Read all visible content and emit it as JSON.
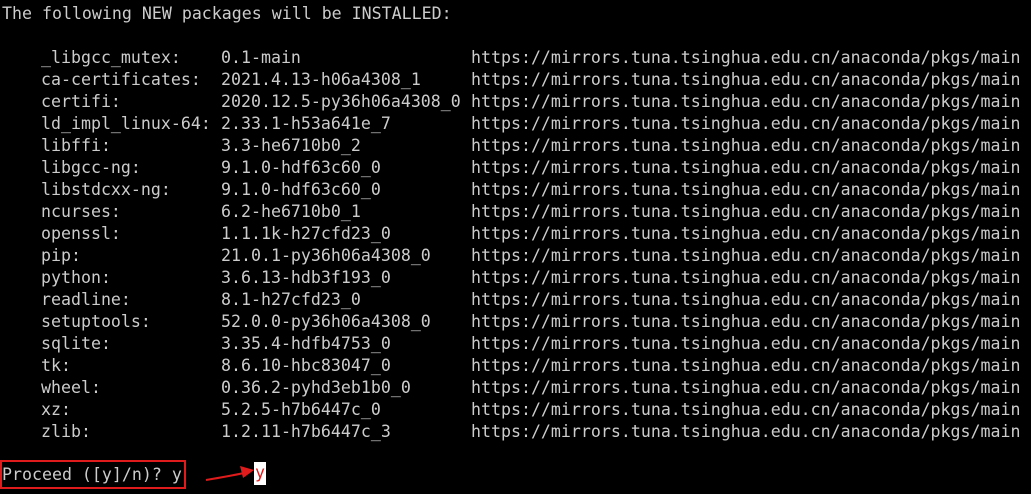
{
  "header": "The following NEW packages will be INSTALLED:",
  "packages": [
    {
      "name": "_libgcc_mutex:",
      "version": "0.1-main",
      "channel": "https://mirrors.tuna.tsinghua.edu.cn/anaconda/pkgs/main"
    },
    {
      "name": "ca-certificates:",
      "version": "2021.4.13-h06a4308_1",
      "channel": "https://mirrors.tuna.tsinghua.edu.cn/anaconda/pkgs/main"
    },
    {
      "name": "certifi:",
      "version": "2020.12.5-py36h06a4308_0",
      "channel": "https://mirrors.tuna.tsinghua.edu.cn/anaconda/pkgs/main"
    },
    {
      "name": "ld_impl_linux-64:",
      "version": "2.33.1-h53a641e_7",
      "channel": "https://mirrors.tuna.tsinghua.edu.cn/anaconda/pkgs/main"
    },
    {
      "name": "libffi:",
      "version": "3.3-he6710b0_2",
      "channel": "https://mirrors.tuna.tsinghua.edu.cn/anaconda/pkgs/main"
    },
    {
      "name": "libgcc-ng:",
      "version": "9.1.0-hdf63c60_0",
      "channel": "https://mirrors.tuna.tsinghua.edu.cn/anaconda/pkgs/main"
    },
    {
      "name": "libstdcxx-ng:",
      "version": "9.1.0-hdf63c60_0",
      "channel": "https://mirrors.tuna.tsinghua.edu.cn/anaconda/pkgs/main"
    },
    {
      "name": "ncurses:",
      "version": "6.2-he6710b0_1",
      "channel": "https://mirrors.tuna.tsinghua.edu.cn/anaconda/pkgs/main"
    },
    {
      "name": "openssl:",
      "version": "1.1.1k-h27cfd23_0",
      "channel": "https://mirrors.tuna.tsinghua.edu.cn/anaconda/pkgs/main"
    },
    {
      "name": "pip:",
      "version": "21.0.1-py36h06a4308_0",
      "channel": "https://mirrors.tuna.tsinghua.edu.cn/anaconda/pkgs/main"
    },
    {
      "name": "python:",
      "version": "3.6.13-hdb3f193_0",
      "channel": "https://mirrors.tuna.tsinghua.edu.cn/anaconda/pkgs/main"
    },
    {
      "name": "readline:",
      "version": "8.1-h27cfd23_0",
      "channel": "https://mirrors.tuna.tsinghua.edu.cn/anaconda/pkgs/main"
    },
    {
      "name": "setuptools:",
      "version": "52.0.0-py36h06a4308_0",
      "channel": "https://mirrors.tuna.tsinghua.edu.cn/anaconda/pkgs/main"
    },
    {
      "name": "sqlite:",
      "version": "3.35.4-hdfb4753_0",
      "channel": "https://mirrors.tuna.tsinghua.edu.cn/anaconda/pkgs/main"
    },
    {
      "name": "tk:",
      "version": "8.6.10-hbc83047_0",
      "channel": "https://mirrors.tuna.tsinghua.edu.cn/anaconda/pkgs/main"
    },
    {
      "name": "wheel:",
      "version": "0.36.2-pyhd3eb1b0_0",
      "channel": "https://mirrors.tuna.tsinghua.edu.cn/anaconda/pkgs/main"
    },
    {
      "name": "xz:",
      "version": "5.2.5-h7b6447c_0",
      "channel": "https://mirrors.tuna.tsinghua.edu.cn/anaconda/pkgs/main"
    },
    {
      "name": "zlib:",
      "version": "1.2.11-h7b6447c_3",
      "channel": "https://mirrors.tuna.tsinghua.edu.cn/anaconda/pkgs/main"
    }
  ],
  "prompt": "Proceed ([y]/n)? y",
  "input_echo": "y",
  "colors": {
    "background": "#000000",
    "text": "#cccccc",
    "annotation": "#e01b1b",
    "cursor": "#ffffff"
  },
  "icons": {
    "annotation_arrow": "red-arrow-icon"
  }
}
